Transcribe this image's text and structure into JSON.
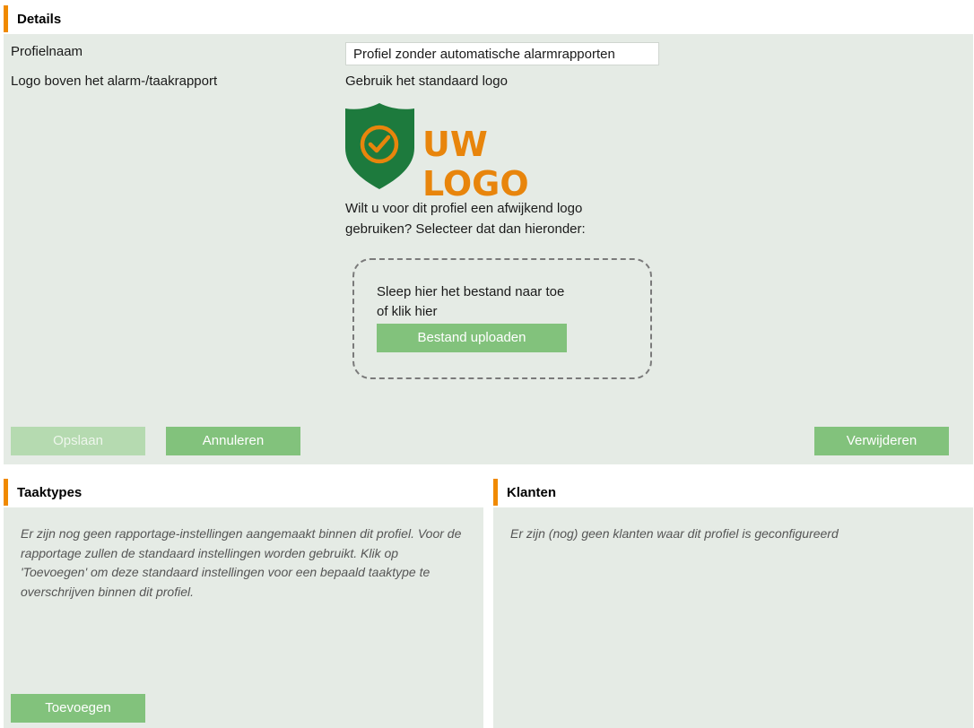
{
  "details": {
    "title": "Details",
    "profile_name_label": "Profielnaam",
    "profile_name_value": "Profiel zonder automatische alarmrapporten",
    "logo_label": "Logo boven het alarm-/taakrapport",
    "logo_status": "Gebruik het standaard logo",
    "logo_text": "UW LOGO",
    "custom_logo_prompt_line1": "Wilt u voor dit profiel een afwijkend logo",
    "custom_logo_prompt_line2": "gebruiken? Selecteer dat dan hieronder:",
    "dropzone_line1": "Sleep hier het bestand naar toe",
    "dropzone_line2": "of klik hier",
    "upload_button": "Bestand uploaden",
    "save_button": "Opslaan",
    "cancel_button": "Annuleren",
    "delete_button": "Verwijderen"
  },
  "task_types": {
    "title": "Taaktypes",
    "empty_message": "Er zijn nog geen rapportage-instellingen aangemaakt binnen dit profiel. Voor de rapportage zullen de standaard instellingen worden gebruikt. Klik op 'Toevoegen' om deze standaard instellingen voor een bepaald taaktype te overschrijven binnen dit profiel.",
    "add_button": "Toevoegen"
  },
  "clients": {
    "title": "Klanten",
    "empty_message": "Er zijn (nog) geen klanten waar dit profiel is geconfigureerd"
  },
  "colors": {
    "accent": "#f08a00",
    "panel_bg": "#e5ebe5",
    "button": "#82c27c",
    "logo_green": "#1d7a3d",
    "logo_orange": "#e8850c"
  }
}
